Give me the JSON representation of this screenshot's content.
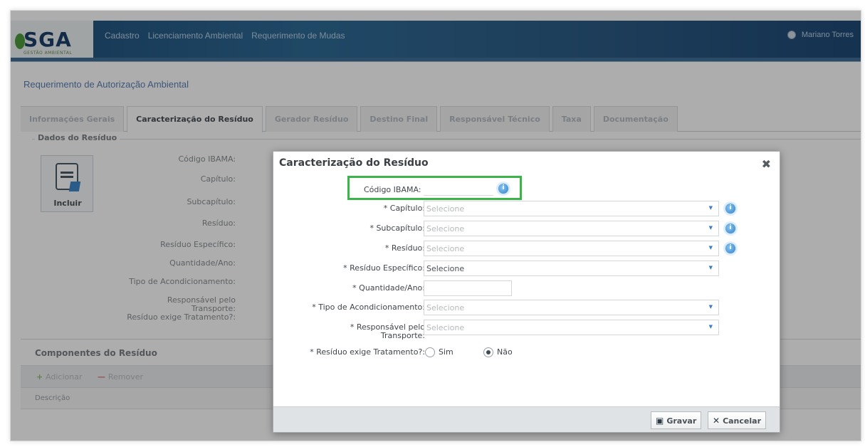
{
  "header": {
    "logo": "SGA",
    "logo_sub": "GESTÃO AMBIENTAL",
    "nav": [
      "Cadastro",
      "Licenciamento Ambiental",
      "Requerimento de Mudas"
    ],
    "user": "Mariano Torres"
  },
  "page": {
    "title": "Requerimento de Autorização Ambiental"
  },
  "tabs": [
    {
      "label": "Informações Gerais",
      "active": false
    },
    {
      "label": "Caracterização do Resíduo",
      "active": true
    },
    {
      "label": "Gerador Resíduo",
      "active": false
    },
    {
      "label": "Destino Final",
      "active": false
    },
    {
      "label": "Responsável Técnico",
      "active": false
    },
    {
      "label": "Taxa",
      "active": false
    },
    {
      "label": "Documentação",
      "active": false
    }
  ],
  "residue_panel": {
    "legend": "Dados do Resíduo",
    "include_label": "Incluir",
    "labels": [
      "Código IBAMA:",
      "Capítulo:",
      "Subcapítulo:",
      "Resíduo:",
      "Resíduo Específico:",
      "Quantidade/Ano:",
      "Tipo de Acondicionamento:",
      "Responsável pelo",
      "Transporte:",
      "Resíduo exige Tratamento?:"
    ]
  },
  "components": {
    "title": "Componentes do Resíduo",
    "add_label": "Adicionar",
    "remove_label": "Remover",
    "column_header": "Descrição"
  },
  "modal": {
    "title": "Caracterização do Resíduo",
    "close_symbol": "✖",
    "ibama_label": "Código IBAMA:",
    "ibama_value": "",
    "capitulo_label": "* Capítulo:",
    "capitulo_value": "Selecione",
    "subcapitulo_label": "* Subcapítulo:",
    "subcapitulo_value": "Selecione",
    "residuo_label": "* Resíduo:",
    "residuo_value": "Selecione",
    "residuo_especifico_label": "* Resíduo Específico:",
    "residuo_especifico_value": "Selecione",
    "quantidade_label": "* Quantidade/Ano:",
    "quantidade_value": "",
    "acondicionamento_label": "* Tipo de Acondicionamento:",
    "acondicionamento_value": "Selecione",
    "responsavel_label_1": "* Responsável pelo",
    "responsavel_label_2": "Transporte:",
    "responsavel_value": "Selecione",
    "tratamento_label": "* Resíduo exige Tratamento?:",
    "option_sim": "Sim",
    "option_nao": "Não",
    "tratamento_selected": "Não",
    "save_label": "Gravar",
    "cancel_label": "Cancelar"
  },
  "colors": {
    "highlight": "#3bb54a",
    "header_blue": "#2f6b97",
    "info_blue": "#2e7ec9"
  },
  "icons": {
    "include": "document-edit-icon",
    "info": "info-icon",
    "save": "floppy-icon",
    "cancel": "x-icon",
    "close": "close-icon"
  }
}
